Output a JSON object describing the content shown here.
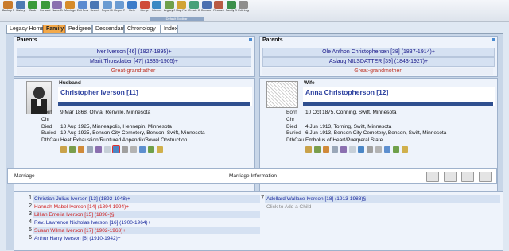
{
  "toolbar": {
    "buttons": [
      {
        "label": "Backup Family",
        "color": "#c97b2c"
      },
      {
        "label": "History",
        "color": "#4d7ab3"
      },
      {
        "label": "Back",
        "color": "#3a9a3a"
      },
      {
        "label": "Forward",
        "color": "#3a9a3a"
      },
      {
        "label": "Name Edit",
        "color": "#8a6fb0"
      },
      {
        "label": "Marriage Edit",
        "color": "#d68b2a"
      },
      {
        "label": "Edit Person",
        "color": "#5a8ad0"
      },
      {
        "label": "Search",
        "color": "#4b77b5"
      },
      {
        "label": "Report Menu",
        "color": "#6a9bd2"
      },
      {
        "label": "Report Recent",
        "color": "#6a9bd2"
      },
      {
        "label": "Help",
        "color": "#3c7cc9"
      },
      {
        "label": "Merge",
        "color": "#cf4a3a"
      },
      {
        "label": "Internet",
        "color": "#3b8ac4"
      },
      {
        "label": "Legacy Charting",
        "color": "#6fa04a"
      },
      {
        "label": "Map Family",
        "color": "#d1a335"
      },
      {
        "label": "Create CG",
        "color": "#46a07a"
      },
      {
        "label": "Census List",
        "color": "#4b6fb0"
      },
      {
        "label": "Research Guidance",
        "color": "#b85a44"
      },
      {
        "label": "Family Search",
        "color": "#3c8f4c"
      },
      {
        "label": "Edit Legacy",
        "color": "#8d8d8d"
      }
    ],
    "group_label": "Default Toolbar"
  },
  "tabs": [
    "Legacy Home",
    "Family",
    "Pedigree",
    "Descendant",
    "Chronology",
    "Index"
  ],
  "active_tab": "Family",
  "husband_parents": {
    "heading": "Parents",
    "father": "Iver Iverson [46] (1827-1895)+",
    "mother": "Marit Thorsdatter [47] (1835-1905)+",
    "relation": "Great-grandfather"
  },
  "wife_parents": {
    "heading": "Parents",
    "father": "Ole Anthon Christophersen [38] (1837-1914)+",
    "mother": "Aslaug NILSDATTER [39] (1843-1927)+",
    "relation": "Great-grandmother"
  },
  "husband": {
    "role": "Husband",
    "name": "Christopher Iverson [11]",
    "labels": [
      "Born",
      "Chr",
      "Died",
      "Buried",
      "DthCau"
    ],
    "born": "9 Mar 1868, Olivia, Renville, Minnesota",
    "chr": "",
    "died": "18 Aug 1925, Minneapolis, Hennepin, Minnesota",
    "buried": "19 Aug 1925, Benson City Cemetery, Benson, Swift, Minnesota",
    "dthcau": "Heat Exhaustion/Ruptured Appendix/Bowel Obstruction"
  },
  "wife": {
    "role": "Wife",
    "name": "Anna Christopherson [12]",
    "labels": [
      "Born",
      "Chr",
      "Died",
      "Buried",
      "DthCau"
    ],
    "born": "10 Oct 1875, Conning, Swift, Minnesota",
    "chr": "",
    "died": "4 Jun 1913, Torning, Swift, Minnesota",
    "buried": "6 Jun 1913, Benson City Cemetery, Benson, Swift, Minnesota",
    "dthcau": "Embolus of Heart/Puerperal State"
  },
  "marriage": {
    "label": "Marriage",
    "info_title": "Marriage Information"
  },
  "children_left": [
    {
      "num": "1",
      "text": "Christian Julius Iverson [13] (1892-1948)+",
      "color": "#1a2a9e"
    },
    {
      "num": "2",
      "text": "Hannah Mabel Iverson [14] (1894-1994)+",
      "color": "#d02020"
    },
    {
      "num": "3",
      "text": "Lillian Emelia Iverson [15] (1898-)§",
      "color": "#d02020"
    },
    {
      "num": "4",
      "text": "Rev. Lawrence Nicholas Iverson [16] (1900-1964)+",
      "color": "#1a2a9e"
    },
    {
      "num": "5",
      "text": "Susan Wilma Iverson [17] (1902-1963)+",
      "color": "#d02020"
    },
    {
      "num": "6",
      "text": "Arthur Harry Iverson [6] (1910-1942)+",
      "color": "#1a2a9e"
    }
  ],
  "children_right": [
    {
      "num": "7",
      "text": "Adellard Wallace Iverson [18] (1913-1988)§",
      "color": "#1a2a9e"
    },
    {
      "num": "",
      "text": "Click to Add a Child",
      "color": "#8a8a8a"
    }
  ]
}
